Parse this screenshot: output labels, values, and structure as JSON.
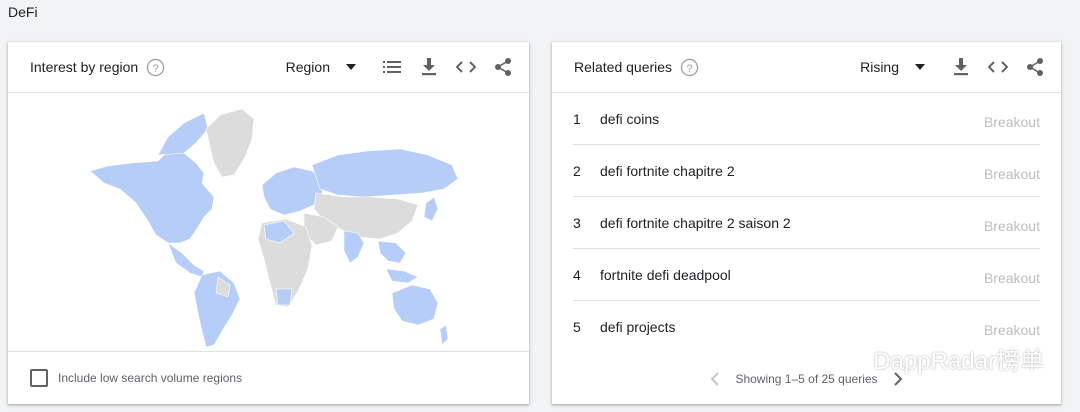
{
  "page": {
    "label": "DeFi"
  },
  "left_card": {
    "title": "Interest by region",
    "dropdown": "Region",
    "checkbox_label": "Include low search volume regions",
    "colors": {
      "active_region": "#b5cdf7",
      "inactive_region": "#dcdcdc"
    }
  },
  "right_card": {
    "title": "Related queries",
    "dropdown": "Rising",
    "rows": [
      {
        "num": "1",
        "query": "defi coins",
        "status": "Breakout"
      },
      {
        "num": "2",
        "query": "defi fortnite chapitre 2",
        "status": "Breakout"
      },
      {
        "num": "3",
        "query": "defi fortnite chapitre 2 saison 2",
        "status": "Breakout"
      },
      {
        "num": "4",
        "query": "fortnite defi deadpool",
        "status": "Breakout"
      },
      {
        "num": "5",
        "query": "defi projects",
        "status": "Breakout"
      }
    ],
    "pager_text": "Showing 1–5 of 25 queries"
  },
  "watermark": {
    "text": "DappRadar榜单"
  }
}
